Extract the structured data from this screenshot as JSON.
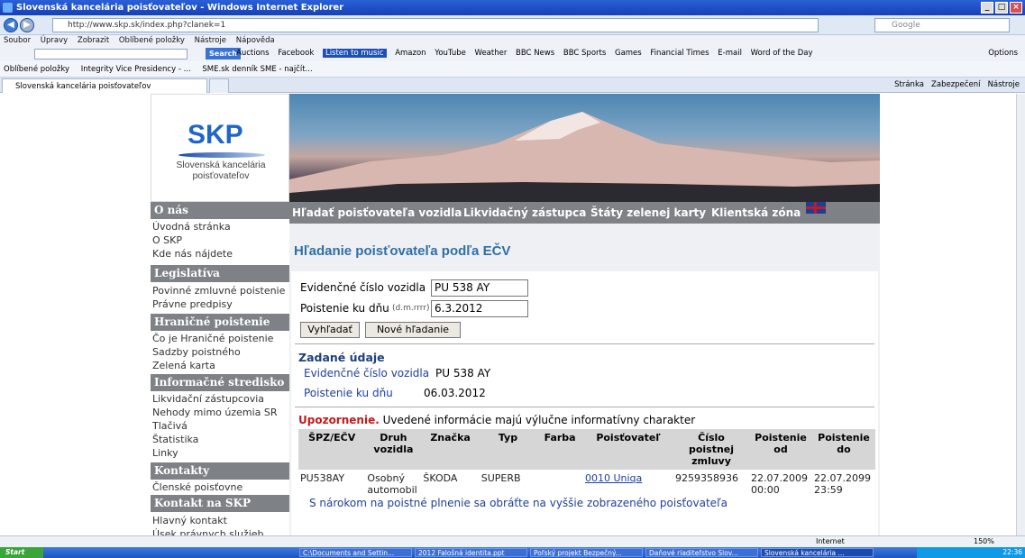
{
  "window": {
    "title": "Slovenská kancelária poisťovateľov - Windows Internet Explorer",
    "controls": [
      "_",
      "□",
      "×"
    ]
  },
  "browser": {
    "address": "http://www.skp.sk/index.php?clanek=1",
    "search_placeholder": "Google",
    "menu": [
      "Soubor",
      "Úpravy",
      "Zobrazit",
      "Oblíbené položky",
      "Nástroje",
      "Nápověda"
    ],
    "toolbar_search_btn": "Search",
    "toolbar_links": [
      "Auctions",
      "Facebook",
      "Listen to music",
      "Amazon",
      "YouTube",
      "Weather",
      "BBC News",
      "BBC Sports",
      "Games",
      "Financial Times",
      "E-mail",
      "Word of the Day"
    ],
    "options": "Options",
    "favorites": [
      "Oblíbené položky",
      "Integrity Vice Presidency - ...",
      "SME.sk denník SME - najčít..."
    ],
    "tab": "Slovenská kancelária poisťovateľov",
    "tab_tools": [
      "Stránka",
      "Zabezpečení",
      "Nástroje"
    ]
  },
  "logo": {
    "title": "SKP",
    "subtitle_line1": "Slovenská kancelária",
    "subtitle_line2": "poisťovateľov"
  },
  "topnav": [
    "Hľadať poisťovateľa vozidla",
    "Likvidačný zástupca",
    "Štáty zelenej karty",
    "Klientská zóna"
  ],
  "sidebar": {
    "sections": [
      {
        "header": "O nás",
        "items": [
          "Úvodná stránka",
          "O SKP",
          "Kde nás nájdete"
        ]
      },
      {
        "header": "Legislatíva",
        "items": [
          "Povinné zmluvné poistenie",
          "Právne predpisy"
        ]
      },
      {
        "header": "Hraničné poistenie",
        "items": [
          "Čo je Hraničné poistenie",
          "Sadzby poistného",
          "Zelená karta"
        ]
      },
      {
        "header": "Informačné stredisko",
        "items": [
          "Likvidační zástupcovia",
          "Nehody mimo územia SR",
          "Tlačivá",
          "Štatistika",
          "Linky"
        ]
      },
      {
        "header": "Kontakty",
        "items": [
          "Členské poisťovne"
        ]
      },
      {
        "header": "Kontakt na SKP",
        "items": [
          "Hlavný kontakt",
          "Úsek právnych služieb"
        ]
      }
    ]
  },
  "main": {
    "title": "Hľadanie poisťovateľa podľa EČV",
    "form": {
      "ecv_label": "Evidenčné číslo vozidla",
      "ecv_value": "PU 538 AY",
      "date_label": "Poistenie ku dňu",
      "date_hint": "(d.m.rrrr)",
      "date_value": "6.3.2012",
      "search_btn": "Vyhľadať",
      "new_btn": "Nové hľadanie"
    },
    "entered": {
      "header": "Zadané údaje",
      "ecv_label": "Evidenčné číslo vozidla",
      "ecv_value": "PU 538 AY",
      "date_label": "Poistenie ku dňu",
      "date_value": "06.03.2012"
    },
    "warning_strong": "Upozornenie.",
    "warning_text": "Uvedené informácie majú výlučne informatívny charakter",
    "table": {
      "headers": [
        "ŠPZ/EČV",
        "Druh vozidla",
        "Značka",
        "Typ",
        "Farba",
        "Poisťovateľ",
        "Číslo poistnej zmluvy",
        "Poistenie od",
        "Poistenie do"
      ],
      "rows": [
        [
          "PU538AY",
          "Osobný automobil",
          "ŠKODA",
          "SUPERB",
          "",
          "0010 Uniqa",
          "9259358936",
          "22.07.2009 00:00",
          "22.07.2099 23:59"
        ]
      ]
    },
    "claim_note": "S nárokom na poistné plnenie sa obráťte na vyššie zobrazeného poisťovateľa"
  },
  "statusbar": {
    "zone": "Internet",
    "zoom": "150%"
  },
  "taskbar": {
    "start": "Start",
    "tasks": [
      "C:\\Documents and Settin...",
      "2012 Falošná identita.ppt",
      "Poľský projekt Bezpečný...",
      "Daňové riaditeľstvo Slov...",
      "Slovenská kancelária ..."
    ],
    "clock": "22:36"
  }
}
